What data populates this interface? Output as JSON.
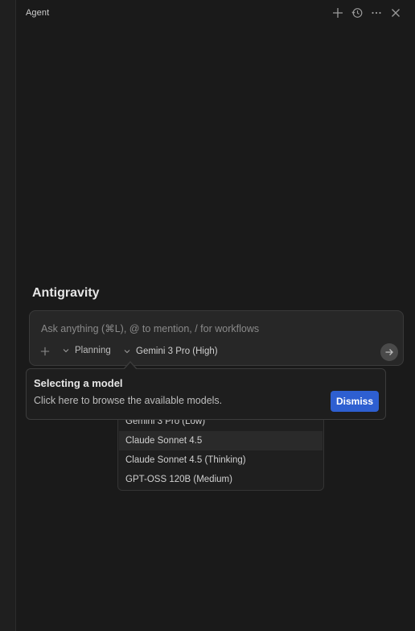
{
  "header": {
    "title": "Agent",
    "actions": [
      {
        "name": "new-chat",
        "icon": "plus-icon"
      },
      {
        "name": "history",
        "icon": "history-icon"
      },
      {
        "name": "more",
        "icon": "ellipsis-icon"
      },
      {
        "name": "close",
        "icon": "close-icon"
      }
    ]
  },
  "brand": "Antigravity",
  "composer": {
    "placeholder": "Ask anything (⌘L), @ to mention, / for workflows",
    "value": "",
    "mode_label": "Planning",
    "model_label": "Gemini 3 Pro (High)"
  },
  "tooltip": {
    "title": "Selecting a model",
    "body": "Click here to browse the available models.",
    "dismiss_label": "Dismiss"
  },
  "model_list": {
    "items": [
      "Gemini 3 Pro (Low)",
      "Claude Sonnet 4.5",
      "Claude Sonnet 4.5 (Thinking)",
      "GPT-OSS 120B (Medium)"
    ],
    "highlighted": "Claude Sonnet 4.5"
  },
  "colors": {
    "background": "#1a1a1a",
    "accent": "#2e5fd1",
    "composer_bg": "#272727"
  }
}
